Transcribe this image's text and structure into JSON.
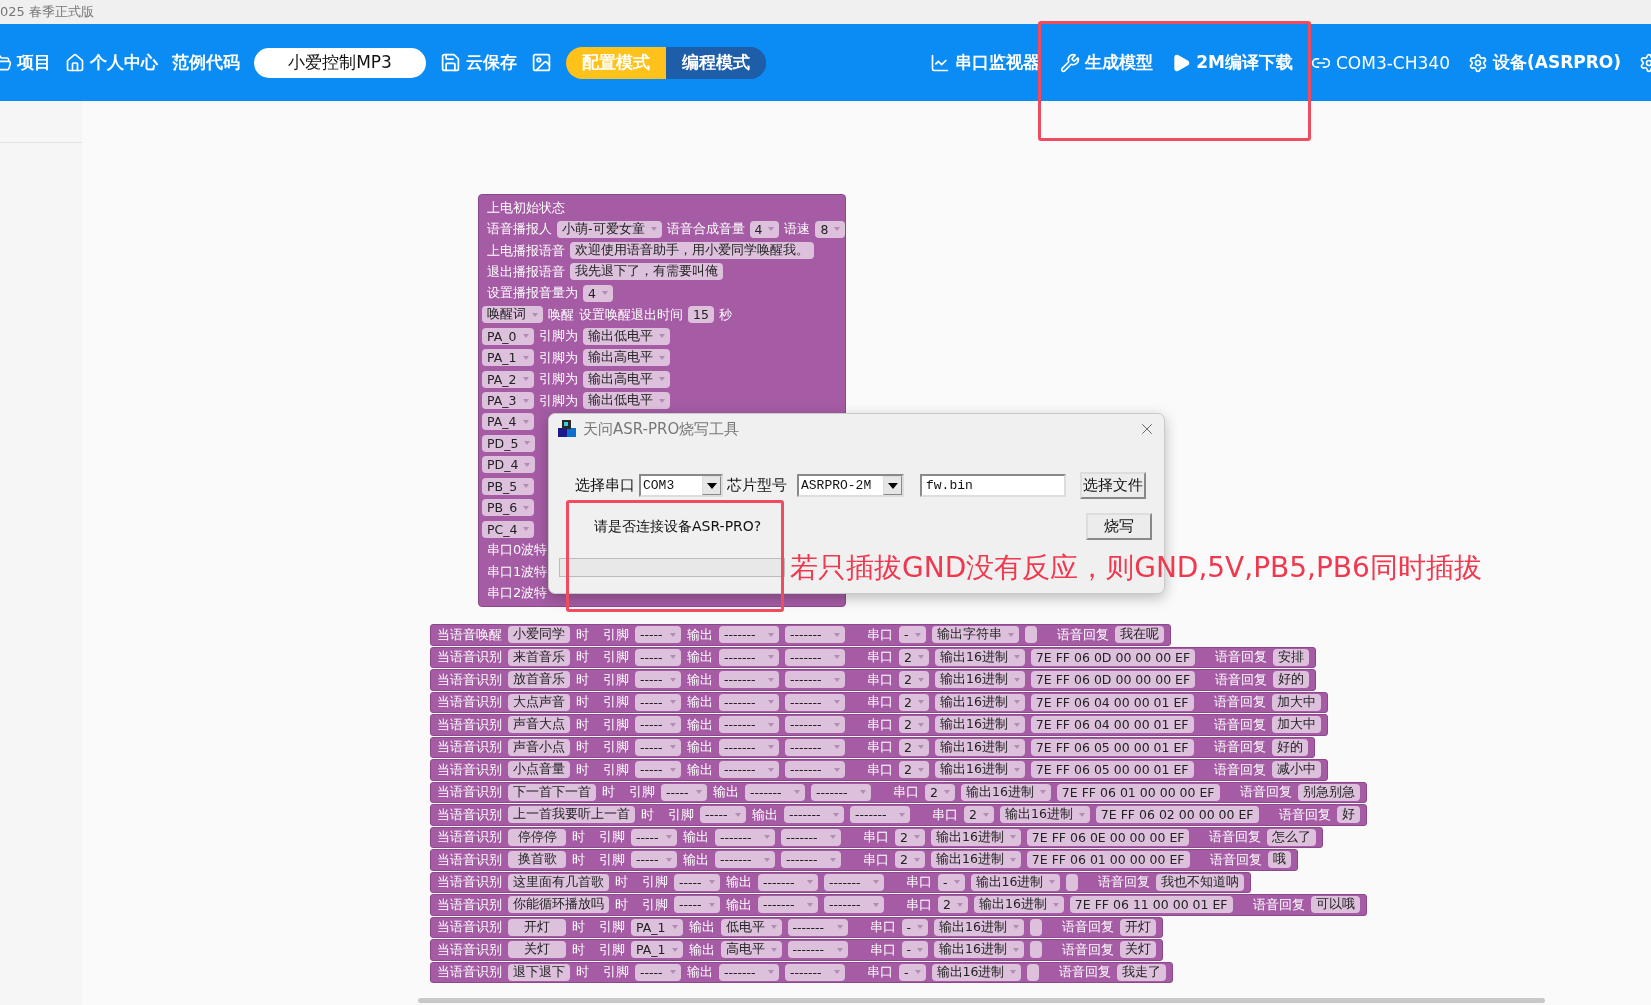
{
  "title_bar": {
    "title": "025 春季正式版"
  },
  "toolbar": {
    "left_items": [
      {
        "label": "项目"
      },
      {
        "label": "个人中心"
      },
      {
        "label": "范例代码"
      }
    ],
    "project_name": "小爱控制MP3",
    "save_label": "云保存",
    "modes": [
      {
        "label": "配置模式",
        "selected": true
      },
      {
        "label": "编程模式",
        "selected": false
      }
    ],
    "right_items": [
      {
        "label": "串口监视器"
      },
      {
        "label": "生成模型"
      },
      {
        "label": "2M编译下载"
      },
      {
        "label": "COM3-CH340"
      },
      {
        "label": "设备(ASRPRO)"
      }
    ]
  },
  "init_block": {
    "title": "上电初始状态",
    "rows": [
      [
        {
          "kind": "text",
          "text": "语音播报人"
        },
        {
          "kind": "dropdown",
          "value": "小萌-可爱女童"
        },
        {
          "kind": "text",
          "text": "语音合成音量"
        },
        {
          "kind": "dropdown",
          "value": "4"
        },
        {
          "kind": "text",
          "text": "语速"
        },
        {
          "kind": "dropdown",
          "value": "8"
        }
      ],
      [
        {
          "kind": "text",
          "text": "上电播报语音"
        },
        {
          "kind": "field",
          "value": "欢迎使用语音助手，用小爱同学唤醒我。"
        }
      ],
      [
        {
          "kind": "text",
          "text": "退出播报语音"
        },
        {
          "kind": "field",
          "value": "我先退下了，有需要叫俺"
        }
      ],
      [
        {
          "kind": "text",
          "text": "设置播报音量为"
        },
        {
          "kind": "dropdown",
          "value": "4"
        }
      ],
      [
        {
          "kind": "dropdown",
          "value": "唤醒词"
        },
        {
          "kind": "text",
          "text": "唤醒"
        },
        {
          "kind": "text",
          "text": "设置唤醒退出时间"
        },
        {
          "kind": "field",
          "value": "15"
        },
        {
          "kind": "text",
          "text": "秒"
        }
      ],
      [
        {
          "kind": "dropdown",
          "value": "PA_0"
        },
        {
          "kind": "text",
          "text": "引脚为"
        },
        {
          "kind": "dropdown",
          "value": "输出低电平"
        }
      ],
      [
        {
          "kind": "dropdown",
          "value": "PA_1"
        },
        {
          "kind": "text",
          "text": "引脚为"
        },
        {
          "kind": "dropdown",
          "value": "输出高电平"
        }
      ],
      [
        {
          "kind": "dropdown",
          "value": "PA_2"
        },
        {
          "kind": "text",
          "text": "引脚为"
        },
        {
          "kind": "dropdown",
          "value": "输出高电平"
        }
      ],
      [
        {
          "kind": "dropdown",
          "value": "PA_3"
        },
        {
          "kind": "text",
          "text": "引脚为"
        },
        {
          "kind": "dropdown",
          "value": "输出低电平"
        }
      ],
      [
        {
          "kind": "dropdown",
          "value": "PA_4"
        }
      ],
      [
        {
          "kind": "dropdown",
          "value": "PD_5"
        }
      ],
      [
        {
          "kind": "dropdown",
          "value": "PD_4"
        }
      ],
      [
        {
          "kind": "dropdown",
          "value": "PB_5"
        }
      ],
      [
        {
          "kind": "dropdown",
          "value": "PB_6"
        }
      ],
      [
        {
          "kind": "dropdown",
          "value": "PC_4"
        }
      ],
      [
        {
          "kind": "text",
          "text": "串口0波特"
        }
      ],
      [
        {
          "kind": "text",
          "text": "串口1波特"
        }
      ],
      [
        {
          "kind": "text",
          "text": "串口2波特"
        }
      ]
    ]
  },
  "event_rows": [
    {
      "trigger": "当语音唤醒",
      "keyword": "小爱同学",
      "at": "时",
      "pin_label": "引脚",
      "pin": "-----",
      "output_label": "输出",
      "output": "-------",
      "output_2": "-------",
      "port_label": "串口",
      "port": "-",
      "mode": "输出字符串",
      "reply_label": "语音回复",
      "reply": "我在呢"
    },
    {
      "trigger": "当语音识别",
      "keyword": "来首音乐",
      "at": "时",
      "pin_label": "引脚",
      "pin": "-----",
      "output_label": "输出",
      "output": "-------",
      "output_2": "-------",
      "port_label": "串口",
      "port": "2",
      "mode": "输出16进制",
      "value": "7E FF 06 0D 00 00 00 EF",
      "reply_label": "语音回复",
      "reply": "安排"
    },
    {
      "trigger": "当语音识别",
      "keyword": "放首音乐",
      "at": "时",
      "pin_label": "引脚",
      "pin": "-----",
      "output_label": "输出",
      "output": "-------",
      "output_2": "-------",
      "port_label": "串口",
      "port": "2",
      "mode": "输出16进制",
      "value": "7E FF 06 0D 00 00 00 EF",
      "reply_label": "语音回复",
      "reply": "好的"
    },
    {
      "trigger": "当语音识别",
      "keyword": "大点声音",
      "at": "时",
      "pin_label": "引脚",
      "pin": "-----",
      "output_label": "输出",
      "output": "-------",
      "output_2": "-------",
      "port_label": "串口",
      "port": "2",
      "mode": "输出16进制",
      "value": "7E FF 06 04 00 00 01 EF",
      "reply_label": "语音回复",
      "reply": "加大中"
    },
    {
      "trigger": "当语音识别",
      "keyword": "声音大点",
      "at": "时",
      "pin_label": "引脚",
      "pin": "-----",
      "output_label": "输出",
      "output": "-------",
      "output_2": "-------",
      "port_label": "串口",
      "port": "2",
      "mode": "输出16进制",
      "value": "7E FF 06 04 00 00 01 EF",
      "reply_label": "语音回复",
      "reply": "加大中"
    },
    {
      "trigger": "当语音识别",
      "keyword": "声音小点",
      "at": "时",
      "pin_label": "引脚",
      "pin": "-----",
      "output_label": "输出",
      "output": "-------",
      "output_2": "-------",
      "port_label": "串口",
      "port": "2",
      "mode": "输出16进制",
      "value": "7E FF 06 05 00 00 01 EF",
      "reply_label": "语音回复",
      "reply": "好的"
    },
    {
      "trigger": "当语音识别",
      "keyword": "小点音量",
      "at": "时",
      "pin_label": "引脚",
      "pin": "-----",
      "output_label": "输出",
      "output": "-------",
      "output_2": "-------",
      "port_label": "串口",
      "port": "2",
      "mode": "输出16进制",
      "value": "7E FF 06 05 00 00 01 EF",
      "reply_label": "语音回复",
      "reply": "减小中"
    },
    {
      "trigger": "当语音识别",
      "keyword": "下一首下一首",
      "at": "时",
      "pin_label": "引脚",
      "pin": "-----",
      "output_label": "输出",
      "output": "-------",
      "output_2": "-------",
      "port_label": "串口",
      "port": "2",
      "mode": "输出16进制",
      "value": "7E FF 06 01 00 00 00 EF",
      "reply_label": "语音回复",
      "reply": "别急别急"
    },
    {
      "trigger": "当语音识别",
      "keyword": "上一首我要听上一首",
      "at": "时",
      "pin_label": "引脚",
      "pin": "-----",
      "output_label": "输出",
      "output": "-------",
      "output_2": "-------",
      "port_label": "串口",
      "port": "2",
      "mode": "输出16进制",
      "value": "7E FF 06 02 00 00 00 EF",
      "reply_label": "语音回复",
      "reply": "好"
    },
    {
      "trigger": "当语音识别",
      "keyword": "停停停",
      "at": "时",
      "pin_label": "引脚",
      "pin": "-----",
      "output_label": "输出",
      "output": "-------",
      "output_2": "-------",
      "port_label": "串口",
      "port": "2",
      "mode": "输出16进制",
      "value": "7E FF 06 0E 00 00 00 EF",
      "reply_label": "语音回复",
      "reply": "怎么了"
    },
    {
      "trigger": "当语音识别",
      "keyword": "换首歌",
      "at": "时",
      "pin_label": "引脚",
      "pin": "-----",
      "output_label": "输出",
      "output": "-------",
      "output_2": "-------",
      "port_label": "串口",
      "port": "2",
      "mode": "输出16进制",
      "value": "7E FF 06 01 00 00 00 EF",
      "reply_label": "语音回复",
      "reply": "哦"
    },
    {
      "trigger": "当语音识别",
      "keyword": "这里面有几首歌",
      "at": "时",
      "pin_label": "引脚",
      "pin": "-----",
      "output_label": "输出",
      "output": "-------",
      "output_2": "-------",
      "port_label": "串口",
      "port": "-",
      "mode": "输出16进制",
      "reply_label": "语音回复",
      "reply": "我也不知道呐"
    },
    {
      "trigger": "当语音识别",
      "keyword": "你能循环播放吗",
      "at": "时",
      "pin_label": "引脚",
      "pin": "-----",
      "output_label": "输出",
      "output": "-------",
      "output_2": "-------",
      "port_label": "串口",
      "port": "2",
      "mode": "输出16进制",
      "value": "7E FF 06 11 00 00 01 EF",
      "reply_label": "语音回复",
      "reply": "可以哦"
    },
    {
      "trigger": "当语音识别",
      "keyword": "开灯",
      "at": "时",
      "pin_label": "引脚",
      "pin": "PA_1",
      "output_label": "输出",
      "output": "低电平",
      "output_2": "-------",
      "port_label": "串口",
      "port": "-",
      "mode": "输出16进制",
      "reply_label": "语音回复",
      "reply": "开灯"
    },
    {
      "trigger": "当语音识别",
      "keyword": "关灯",
      "at": "时",
      "pin_label": "引脚",
      "pin": "PA_1",
      "output_label": "输出",
      "output": "高电平",
      "output_2": "-------",
      "port_label": "串口",
      "port": "-",
      "mode": "输出16进制",
      "reply_label": "语音回复",
      "reply": "关灯"
    },
    {
      "trigger": "当语音识别",
      "keyword": "退下退下",
      "at": "时",
      "pin_label": "引脚",
      "pin": "-----",
      "output_label": "输出",
      "output": "-------",
      "output_2": "-------",
      "port_label": "串口",
      "port": "-",
      "mode": "输出16进制",
      "reply_label": "语音回复",
      "reply": "我走了"
    }
  ],
  "dialog": {
    "title": "天问ASR-PRO烧写工具",
    "port_label": "选择串口",
    "port": "COM3",
    "chip_label": "芯片型号",
    "chip": "ASRPRO-2M",
    "file": "fw.bin",
    "choose_button": "选择文件",
    "burn_button": "烧写",
    "prompt": "请是否连接设备ASR-PRO?",
    "progress": {
      "level": 0
    }
  },
  "annotation_note": "若只插拔GND没有反应，则GND,5V,PB5,PB6同时插拔"
}
